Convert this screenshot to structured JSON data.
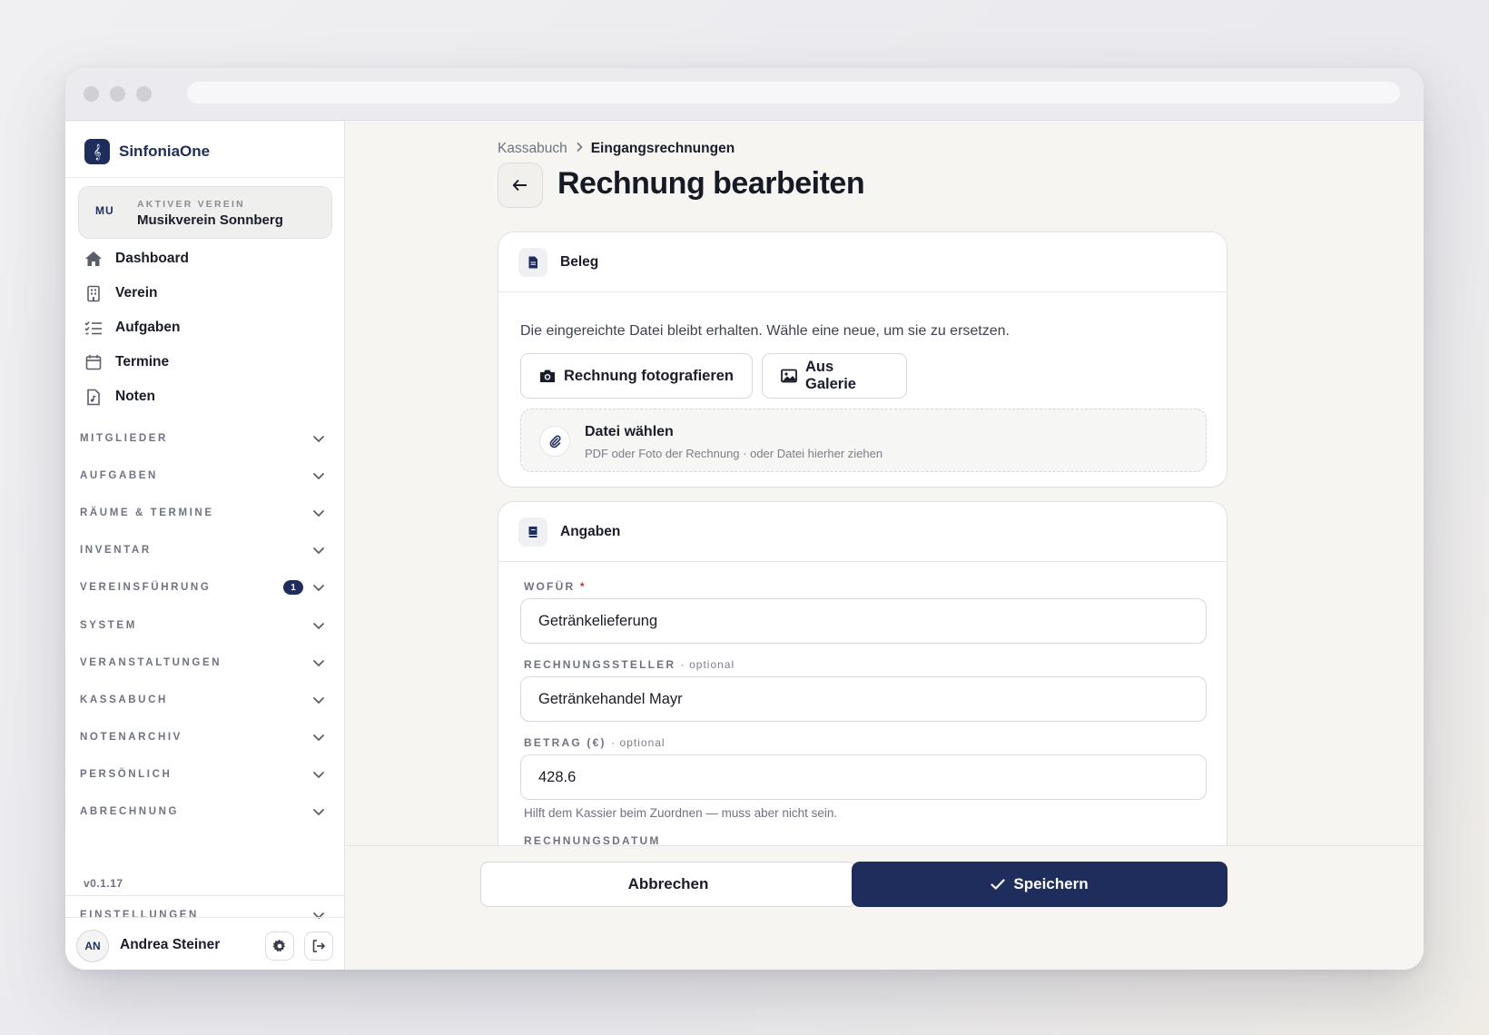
{
  "brand": {
    "name": "SinfoniaOne",
    "logo_icon": "treble-clef-icon"
  },
  "club": {
    "avatar": "MU",
    "label": "AKTIVER VEREIN",
    "name": "Musikverein Sonnberg"
  },
  "nav": [
    {
      "label": "Dashboard",
      "icon": "home-icon"
    },
    {
      "label": "Verein",
      "icon": "building-icon"
    },
    {
      "label": "Aufgaben",
      "icon": "checklist-icon"
    },
    {
      "label": "Termine",
      "icon": "calendar-icon"
    },
    {
      "label": "Noten",
      "icon": "music-file-icon"
    }
  ],
  "sections": [
    {
      "label": "MITGLIEDER"
    },
    {
      "label": "AUFGABEN"
    },
    {
      "label": "RÄUME & TERMINE"
    },
    {
      "label": "INVENTAR"
    },
    {
      "label": "VEREINSFÜHRUNG",
      "badge": "1"
    },
    {
      "label": "SYSTEM"
    },
    {
      "label": "VERANSTALTUNGEN"
    },
    {
      "label": "KASSABUCH"
    },
    {
      "label": "NOTENARCHIV"
    },
    {
      "label": "PERSÖNLICH"
    },
    {
      "label": "ABRECHNUNG"
    }
  ],
  "version": "v0.1.17",
  "settings_section": {
    "label": "EINSTELLUNGEN"
  },
  "user": {
    "avatar": "AN",
    "name": "Andrea Steiner"
  },
  "breadcrumb": {
    "parent": "Kassabuch",
    "current": "Eingangsrechnungen"
  },
  "page": {
    "title": "Rechnung bearbeiten"
  },
  "beleg": {
    "title": "Beleg",
    "hint": "Die eingereichte Datei bleibt erhalten. Wähle eine neue, um sie zu ersetzen.",
    "photo_button": "Rechnung fotografieren",
    "gallery_button": "Aus Galerie",
    "dropzone_title": "Datei wählen",
    "dropzone_sub": "PDF oder Foto der Rechnung · oder Datei hierher ziehen"
  },
  "angaben": {
    "title": "Angaben",
    "wofuer_label": "WOFÜR",
    "required_mark": "*",
    "wofuer_value": "Getränkelieferung",
    "steller_label": "RECHNUNGSSTELLER",
    "optional_suffix": "· optional",
    "steller_value": "Getränkehandel Mayr",
    "betrag_label": "BETRAG (€)",
    "betrag_value": "428.6",
    "betrag_hint": "Hilft dem Kassier beim Zuordnen — muss aber nicht sein.",
    "datum_label": "RECHNUNGSDATUM"
  },
  "actions": {
    "cancel": "Abbrechen",
    "save": "Speichern"
  },
  "colors": {
    "primary": "#1f2d5c",
    "required": "#c8343a"
  }
}
